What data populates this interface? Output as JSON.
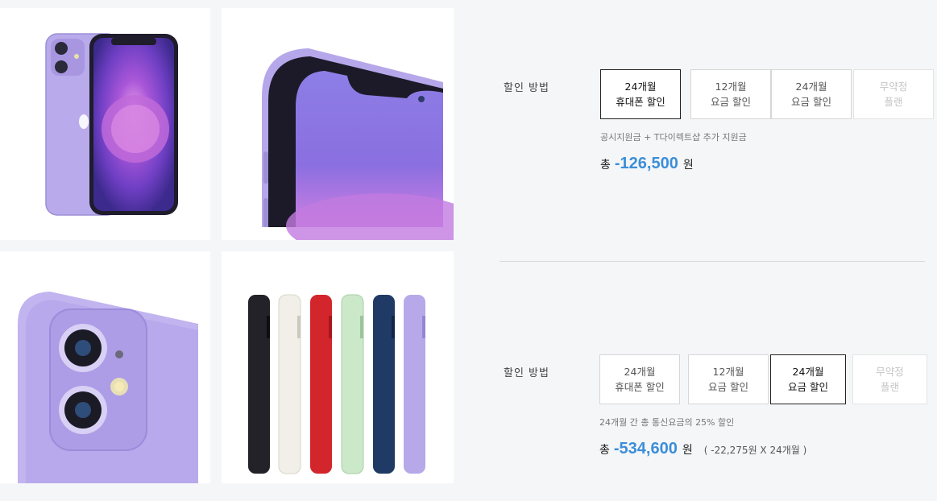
{
  "sections": [
    {
      "label": "할인 방법",
      "options": [
        {
          "line1": "24개월",
          "line2": "휴대폰 할인",
          "state": "selected"
        },
        {
          "line1": "12개월",
          "line2": "요금 할인",
          "state": "normal"
        },
        {
          "line1": "24개월",
          "line2": "요금 할인",
          "state": "normal"
        },
        {
          "line1": "무약정",
          "line2": "플랜",
          "state": "disabled"
        }
      ],
      "note": "공시지원금 + T다이렉트샵 추가 지원금",
      "total_prefix": "총",
      "total_amount": "-126,500",
      "total_unit": "원",
      "total_detail": ""
    },
    {
      "label": "할인 방법",
      "options": [
        {
          "line1": "24개월",
          "line2": "휴대폰 할인",
          "state": "normal"
        },
        {
          "line1": "12개월",
          "line2": "요금 할인",
          "state": "normal"
        },
        {
          "line1": "24개월",
          "line2": "요금 할인",
          "state": "selected"
        },
        {
          "line1": "무약정",
          "line2": "플랜",
          "state": "disabled"
        }
      ],
      "note": "24개월 간 총 통신요금의 25% 할인",
      "total_prefix": "총",
      "total_amount": "-534,600",
      "total_unit": "원",
      "total_detail": "( -22,275원 X 24개월 )"
    }
  ],
  "colors": {
    "accent": "#3b8ed8",
    "phone_purple": "#b7a8ea",
    "background": "#f5f6f8"
  },
  "gallery": [
    {
      "icon": "iphone-front-back-image"
    },
    {
      "icon": "iphone-side-closeup-image"
    },
    {
      "icon": "iphone-camera-closeup-image"
    },
    {
      "icon": "iphone-color-lineup-image"
    }
  ]
}
